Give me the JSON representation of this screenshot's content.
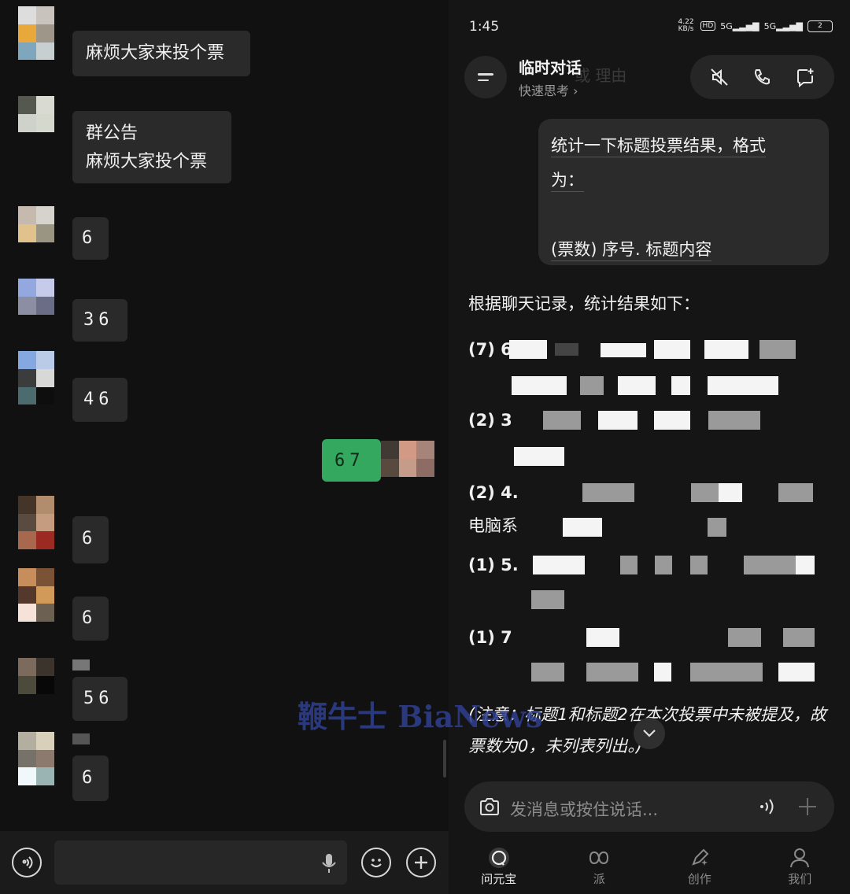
{
  "left_chat": {
    "messages": [
      {
        "text": "麻烦大家来投个票"
      },
      {
        "text_line1": "群公告",
        "text_line2": "麻烦大家投个票"
      },
      {
        "text": "6"
      },
      {
        "text": "36"
      },
      {
        "text": "46"
      },
      {
        "text": "67",
        "self": true
      },
      {
        "text": "6"
      },
      {
        "text": "6"
      },
      {
        "text": "56"
      },
      {
        "text": "6"
      }
    ]
  },
  "status_bar": {
    "time": "1:45",
    "speed": "4.22 KB/s",
    "net1": "5G",
    "net2": "5G",
    "battery": "2"
  },
  "chat_header": {
    "title": "临时对话",
    "subtitle": "快速思考",
    "ghost_text": "或 理由"
  },
  "user_message": {
    "line1": "统计一下标题投票结果，格式",
    "line2": "为：",
    "line3": "(票数) 序号. 标题内容"
  },
  "ai_reply": {
    "intro": "根据聊天记录，统计结果如下：",
    "items": [
      {
        "lead": "(7) 6"
      },
      {
        "lead": "(2) 3"
      },
      {
        "lead": "(2) 4."
      },
      {
        "lead": "(1) 5."
      },
      {
        "lead": "(1) 7"
      }
    ],
    "partial_3": "电脑系",
    "note": "(注意：标题1和标题2在本次投票中未被提及，故票数为0，未列表列出。)"
  },
  "input": {
    "placeholder": "发消息或按住说话..."
  },
  "tabs": [
    {
      "label": "问元宝",
      "active": true
    },
    {
      "label": "派",
      "active": false
    },
    {
      "label": "创作",
      "active": false
    },
    {
      "label": "我们",
      "active": false
    }
  ],
  "watermark": "鞭牛士 BiaNews"
}
